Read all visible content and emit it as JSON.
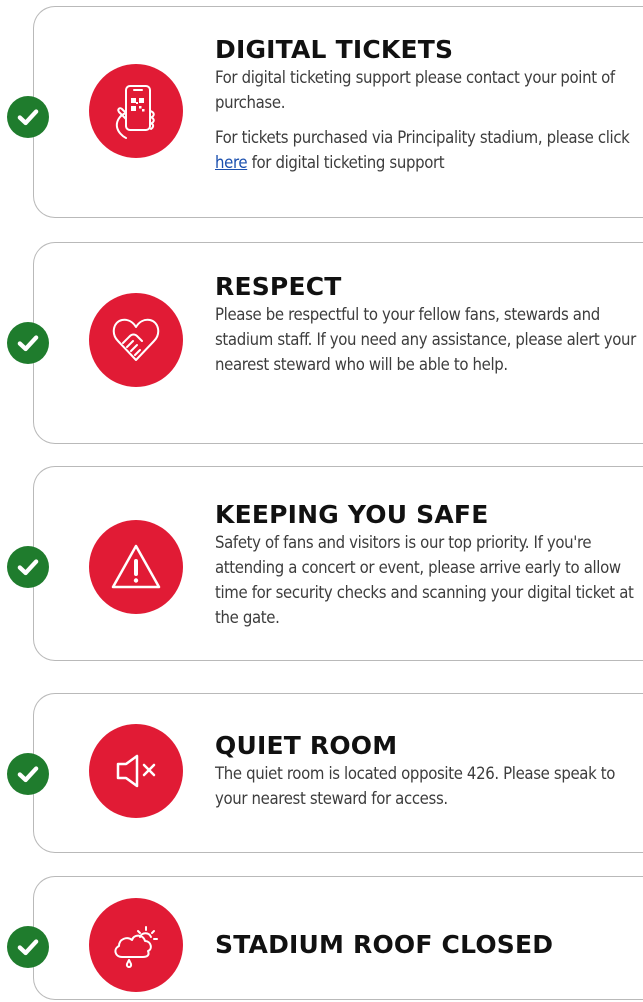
{
  "colors": {
    "accent_red": "#e11b35",
    "check_green": "#1f7c2d",
    "card_border": "#b9b9b9",
    "link_blue": "#1a4fae"
  },
  "sections": [
    {
      "icon": "phone-qr-code-icon",
      "title": "DIGITAL TICKETS",
      "body": "For digital ticketing support please contact your point of purchase.",
      "body2_before": "For tickets purchased via Principality stadium, please click ",
      "body2_link": "here",
      "body2_after": " for digital ticketing support"
    },
    {
      "icon": "handshake-heart-icon",
      "title": "RESPECT",
      "body": "Please be respectful to your fellow fans, stewards and stadium staff.  If you need any assistance, please alert your nearest steward who will be able to help."
    },
    {
      "icon": "warning-triangle-icon",
      "title": "KEEPING YOU SAFE",
      "body": "Safety of fans and visitors is our top priority. If you're attending a concert or event, please arrive early to allow time for security checks and scanning your digital ticket at the gate."
    },
    {
      "icon": "speaker-mute-icon",
      "title": "QUIET ROOM",
      "body": "The quiet room is located opposite 426. Please speak to your nearest steward for access."
    },
    {
      "icon": "cloud-sun-rain-icon",
      "title": "STADIUM ROOF CLOSED"
    }
  ]
}
